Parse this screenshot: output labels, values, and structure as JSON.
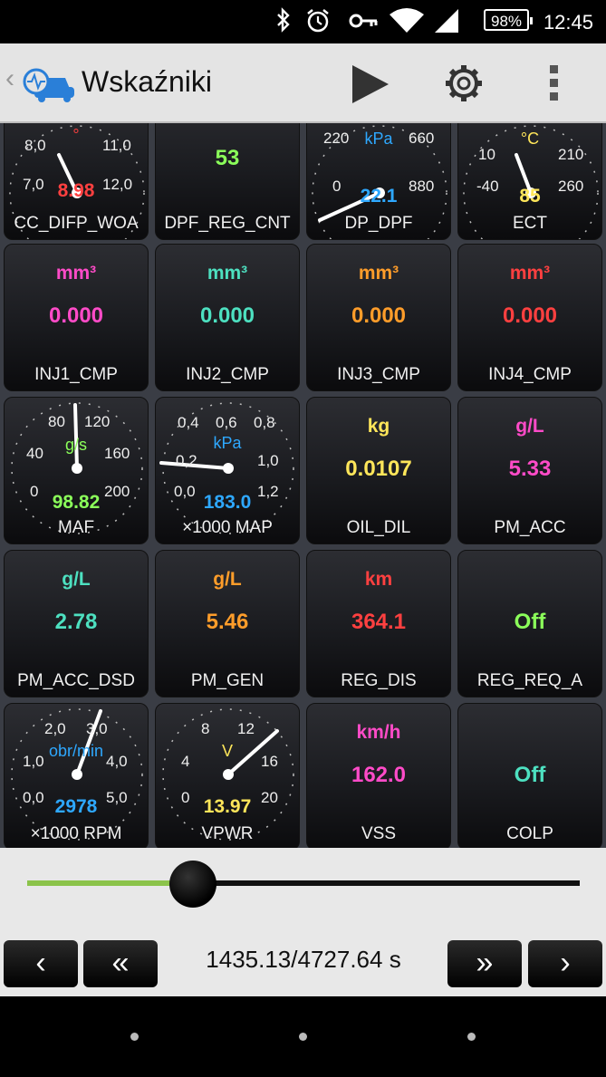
{
  "status_bar": {
    "battery": "98%",
    "time": "12:45"
  },
  "app_bar": {
    "back": "‹",
    "title": "Wskaźniki"
  },
  "colors": {
    "green": "#8bff5a",
    "cyan": "#4de0c0",
    "blue": "#2ea8ff",
    "yellow": "#ffe65a",
    "orange": "#ff9d2a",
    "red": "#ff4040",
    "pink": "#ff4bc8"
  },
  "tiles": [
    {
      "name": "CC_DIFP_WOA",
      "gauge": {
        "ticks": [
          "8,0",
          "11,0",
          "7,0",
          "12,0"
        ],
        "unit": "°",
        "value": "8.98"
      }
    },
    {
      "name": "DPF_REG_CNT",
      "value": "53"
    },
    {
      "name": "DP_DPF",
      "gauge": {
        "ticks": [
          "220",
          "660",
          "0",
          "880"
        ],
        "unit": "kPa",
        "value": "22.1"
      }
    },
    {
      "name": "ECT",
      "gauge": {
        "ticks": [
          "10",
          "210",
          "-40",
          "260"
        ],
        "unit": "°C",
        "value": "85"
      }
    },
    {
      "name": "INJ1_CMP",
      "unit": "mm³",
      "value": "0.000"
    },
    {
      "name": "INJ2_CMP",
      "unit": "mm³",
      "value": "0.000"
    },
    {
      "name": "INJ3_CMP",
      "unit": "mm³",
      "value": "0.000"
    },
    {
      "name": "INJ4_CMP",
      "unit": "mm³",
      "value": "0.000"
    },
    {
      "name": "MAF",
      "gauge": {
        "ticks": [
          "80",
          "120",
          "40",
          "160",
          "0",
          "200"
        ],
        "unit": "g/s",
        "value": "98.82"
      }
    },
    {
      "name": "×1000 MAP",
      "gauge": {
        "ticks": [
          "0,4",
          "0,6",
          "0,8",
          "0,2",
          "1,0",
          "0,0",
          "1,2"
        ],
        "unit": "kPa",
        "value": "183.0"
      }
    },
    {
      "name": "OIL_DIL",
      "unit": "kg",
      "value": "0.0107"
    },
    {
      "name": "PM_ACC",
      "unit": "g/L",
      "value": "5.33"
    },
    {
      "name": "PM_ACC_DSD",
      "unit": "g/L",
      "value": "2.78"
    },
    {
      "name": "PM_GEN",
      "unit": "g/L",
      "value": "5.46"
    },
    {
      "name": "REG_DIS",
      "unit": "km",
      "value": "364.1"
    },
    {
      "name": "REG_REQ_A",
      "value": "Off"
    },
    {
      "name": "×1000 RPM",
      "gauge": {
        "ticks": [
          "2,0",
          "3,0",
          "1,0",
          "4,0",
          "0,0",
          "5,0"
        ],
        "unit": "obr/min",
        "value": "2978"
      }
    },
    {
      "name": "VPWR",
      "gauge": {
        "ticks": [
          "8",
          "12",
          "4",
          "16",
          "0",
          "20"
        ],
        "unit": "V",
        "value": "13.97"
      }
    },
    {
      "name": "VSS",
      "unit": "km/h",
      "value": "162.0"
    },
    {
      "name": "COLP",
      "value": "Off"
    }
  ],
  "playback": {
    "position_fraction": 0.3,
    "time_readout": "1435.13/4727.64 s",
    "prev": "‹",
    "rewind": "«",
    "forward": "»",
    "next": "›"
  }
}
